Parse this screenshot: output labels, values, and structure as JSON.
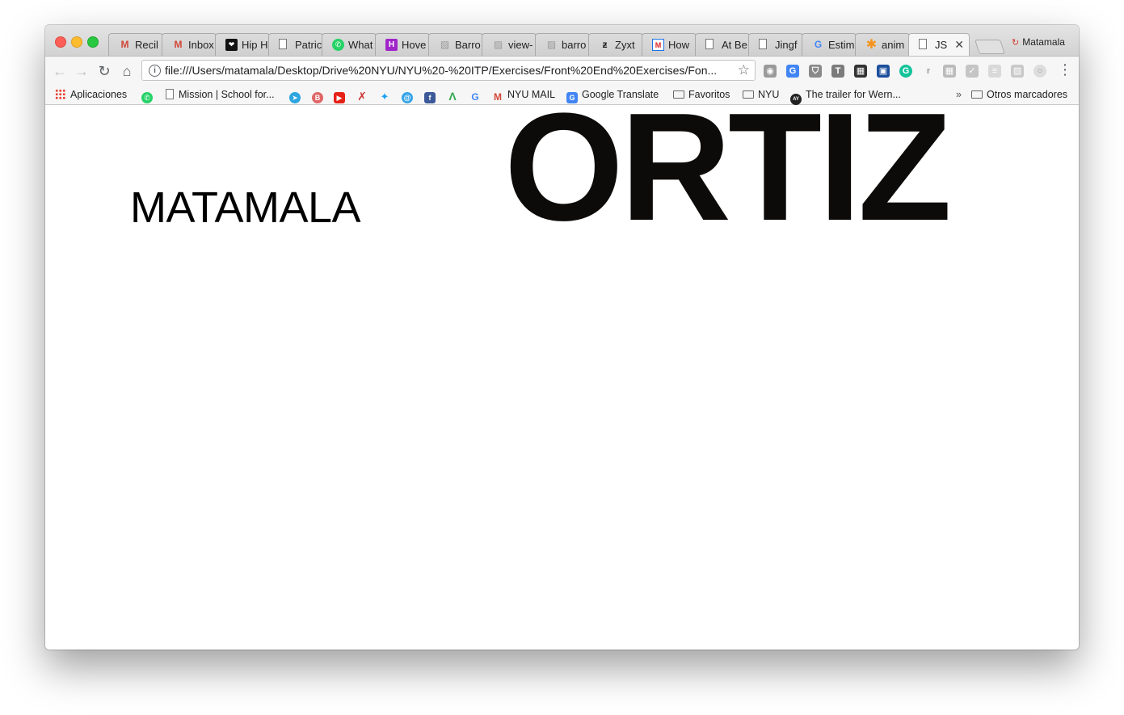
{
  "browser": {
    "profile_name": "Matamala",
    "tabs": [
      {
        "label": "Recil",
        "icon": "gmail-icon",
        "active": false
      },
      {
        "label": "Inbox",
        "icon": "gmail-icon",
        "active": false
      },
      {
        "label": "Hip H",
        "icon": "hiphop-icon",
        "active": false
      },
      {
        "label": "Patric",
        "icon": "page-icon",
        "active": false
      },
      {
        "label": "What",
        "icon": "whatsapp-icon",
        "active": false
      },
      {
        "label": "Hove",
        "icon": "h-icon",
        "active": false
      },
      {
        "label": "Barro",
        "icon": "sketch-icon",
        "active": false
      },
      {
        "label": "view-",
        "icon": "sketch-icon",
        "active": false
      },
      {
        "label": "barro",
        "icon": "sketch-icon",
        "active": false
      },
      {
        "label": "Zyxt",
        "icon": "zyxt-icon",
        "active": false
      },
      {
        "label": "How",
        "icon": "m-icon",
        "active": false
      },
      {
        "label": "At Be",
        "icon": "page-icon",
        "active": false
      },
      {
        "label": "Jingf",
        "icon": "page-icon",
        "active": false
      },
      {
        "label": "Estim",
        "icon": "google-icon",
        "active": false
      },
      {
        "label": "anim",
        "icon": "asterisk-icon",
        "active": false
      },
      {
        "label": "JS",
        "icon": "page-icon",
        "active": true
      }
    ],
    "address_url": "file:///Users/matamala/Desktop/Drive%20NYU/NYU%20-%20ITP/Exercises/Front%20End%20Exercises/Fon...",
    "bookmarks": {
      "apps": "Aplicaciones",
      "mission": "Mission | School for...",
      "nyu_mail": "NYU MAIL",
      "google_translate": "Google Translate",
      "favoritos": "Favoritos",
      "nyu": "NYU",
      "trailer": "The trailer for Wern...",
      "overflow": "»",
      "otros": "Otros marcadores"
    }
  },
  "page": {
    "first_name": "MATAMALA",
    "last_name": "ORTIZ"
  },
  "colors": {
    "gmail": "#d44638",
    "whatsapp": "#25d366",
    "hove": "#a026c9",
    "google_blue": "#4285f4",
    "text": "#0d0b0a"
  }
}
